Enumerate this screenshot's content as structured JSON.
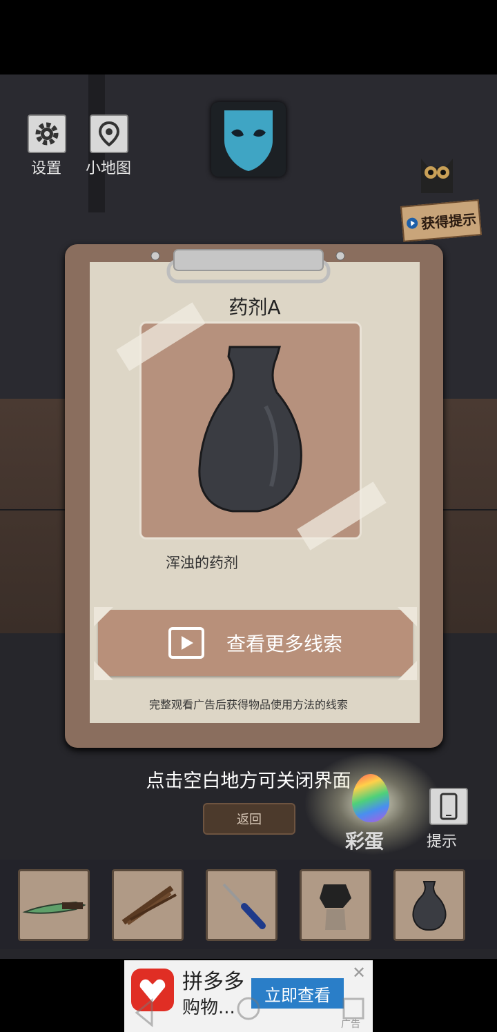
{
  "topbar": {
    "settings_label": "设置",
    "minimap_label": "小地图",
    "hint_sign_label": "获得提示"
  },
  "panel": {
    "item_title": "药剂A",
    "item_description": "浑浊的药剂",
    "clue_button_label": "查看更多线索",
    "clue_note": "完整观看广告后获得物品使用方法的线索"
  },
  "overlay": {
    "close_tip": "点击空白地方可关闭界面",
    "back_label": "返回",
    "easter_egg_label": "彩蛋",
    "hint_label": "提示"
  },
  "inventory": {
    "items": [
      {
        "icon": "knife-icon"
      },
      {
        "icon": "twig-bundle-icon"
      },
      {
        "icon": "screwdriver-icon"
      },
      {
        "icon": "glove-icon"
      },
      {
        "icon": "vase-icon"
      }
    ]
  },
  "ad": {
    "title": "拼多多",
    "subtitle": "购物...",
    "cta": "立即查看",
    "close": "✕",
    "tag": "广告"
  },
  "colors": {
    "paper": "#ddd6c6",
    "clipboard": "#8a6e5e",
    "button": "#b8907a",
    "ad_brand": "#e02e24",
    "ad_cta": "#2a7ec8"
  }
}
